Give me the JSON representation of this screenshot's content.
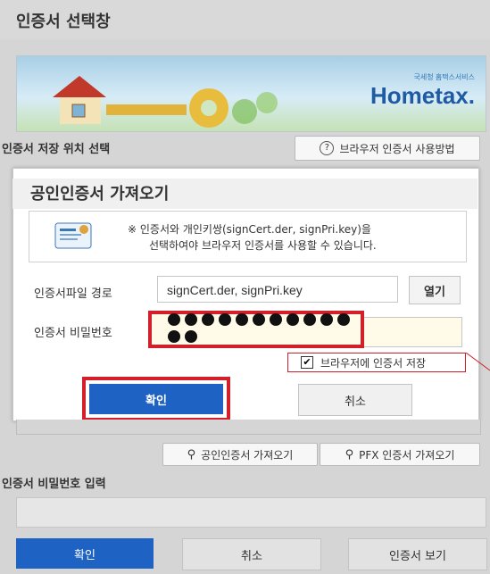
{
  "window": {
    "title": "인증서 선택창"
  },
  "banner": {
    "logo_text": "Hometax.",
    "logo_sub": "국세청 홈택스서비스"
  },
  "location": {
    "label": "인증서 저장 위치 선택",
    "help_button": "브라우저 인증서 사용방법"
  },
  "import_dialog": {
    "title": "공인인증서 가져오기",
    "info_line1": "※ 인증서와 개인키쌍(signCert.der, signPri.key)을",
    "info_line2": "선택하여야 브라우저 인증서를 사용할 수 있습니다.",
    "file_path_label": "인증서파일 경로",
    "file_path_value": "signCert.der, signPri.key",
    "open_button": "열기",
    "password_label": "인증서 비밀번호",
    "password_dot_count": 13,
    "save_checkbox_label": "브라우저에 인증서 저장",
    "save_checked": true,
    "confirm_button": "확인",
    "cancel_button": "취소"
  },
  "actions": {
    "import_cert_button": "공인인증서 가져오기",
    "import_pfx_button": "PFX 인증서 가져오기"
  },
  "password_entry": {
    "label": "인증서 비밀번호 입력",
    "value": ""
  },
  "footer": {
    "confirm_button": "확인",
    "cancel_button": "취소",
    "view_cert_button": "인증서 보기"
  },
  "colors": {
    "primary": "#1e63c3",
    "highlight": "#d21f2a",
    "brand": "#1f5aa5"
  }
}
